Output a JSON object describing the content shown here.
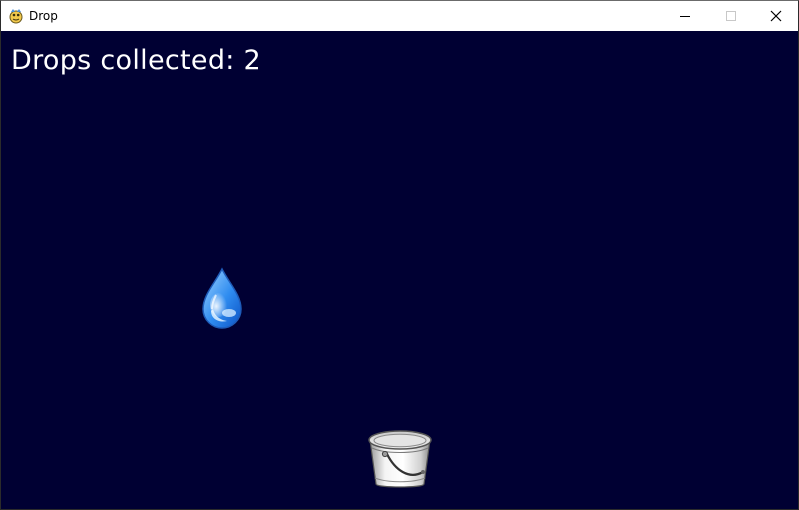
{
  "window": {
    "title": "Drop",
    "app_icon": "pygame-snake-icon",
    "controls": {
      "minimize_icon": "minimize-icon",
      "maximize_icon": "maximize-icon",
      "close_icon": "close-icon"
    }
  },
  "game": {
    "background_color": "#000033",
    "score_label": "Drops collected: 2",
    "score_value": 2,
    "sprites": {
      "raindrop": "raindrop-icon",
      "bucket": "bucket-icon"
    }
  }
}
